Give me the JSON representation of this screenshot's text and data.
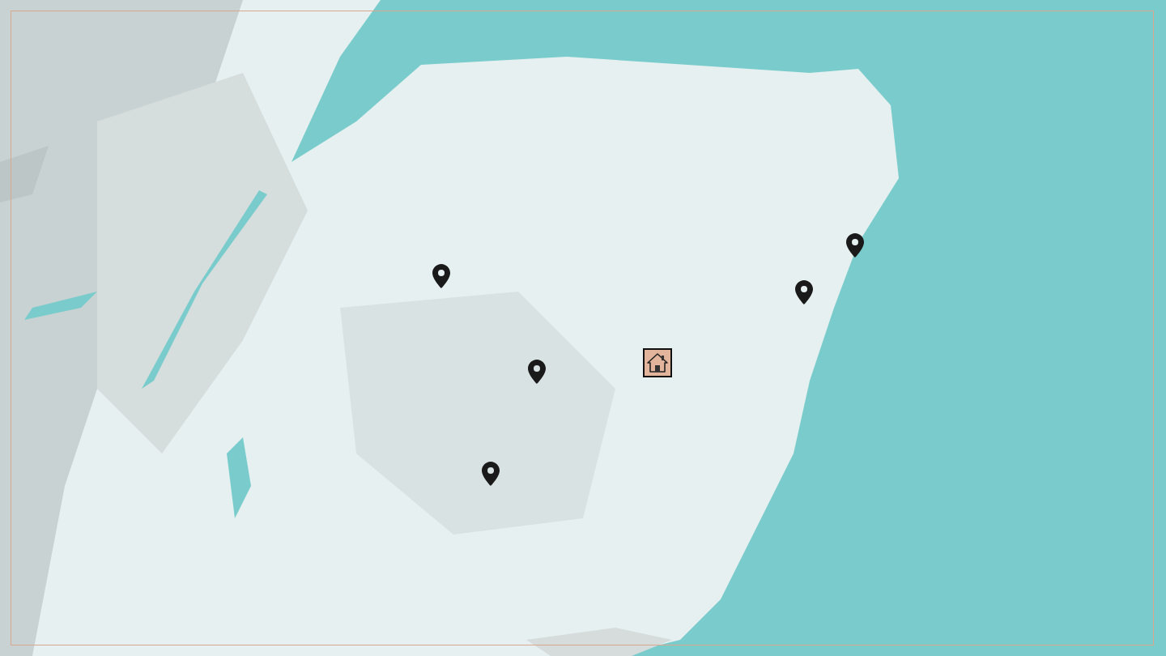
{
  "map": {
    "kind": "picture",
    "markers": [
      {
        "kind": "pin"
      },
      {
        "kind": "pin"
      },
      {
        "kind": "pin"
      },
      {
        "kind": "pin"
      },
      {
        "kind": "pin"
      },
      {
        "kind": "home"
      }
    ]
  }
}
